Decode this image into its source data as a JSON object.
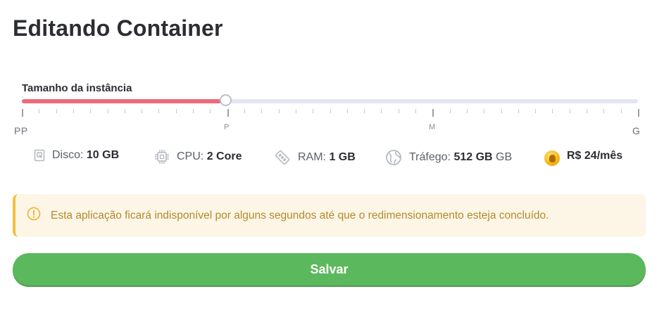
{
  "page": {
    "title": "Editando Container"
  },
  "slider": {
    "label": "Tamanho da instância",
    "value": 0.333,
    "sizes": {
      "pp": "PP",
      "p": "P",
      "m": "M",
      "g": "G"
    }
  },
  "specs": {
    "disk": {
      "label": "Disco:",
      "value": "10 GB",
      "icon": "disk-icon"
    },
    "cpu": {
      "label": "CPU:",
      "value": "2 Core",
      "icon": "cpu-icon"
    },
    "ram": {
      "label": "RAM:",
      "value": "1 GB",
      "icon": "ram-icon"
    },
    "traffic": {
      "label": "Tráfego:",
      "value": "512 GB",
      "unit": "GB",
      "icon": "globe-icon"
    },
    "price": {
      "value": "R$ 24/mês",
      "icon": "coin-icon"
    }
  },
  "alert": {
    "text": "Esta aplicação ficará indisponível por alguns segundos até que o redimensionamento esteja concluído.",
    "icon": "warning-icon",
    "color": "#f3c03f"
  },
  "actions": {
    "save_label": "Salvar",
    "save_color": "#5cb85c"
  },
  "colors": {
    "slider_fill": "#ee6b7a",
    "slider_track": "#e1e6f1"
  }
}
